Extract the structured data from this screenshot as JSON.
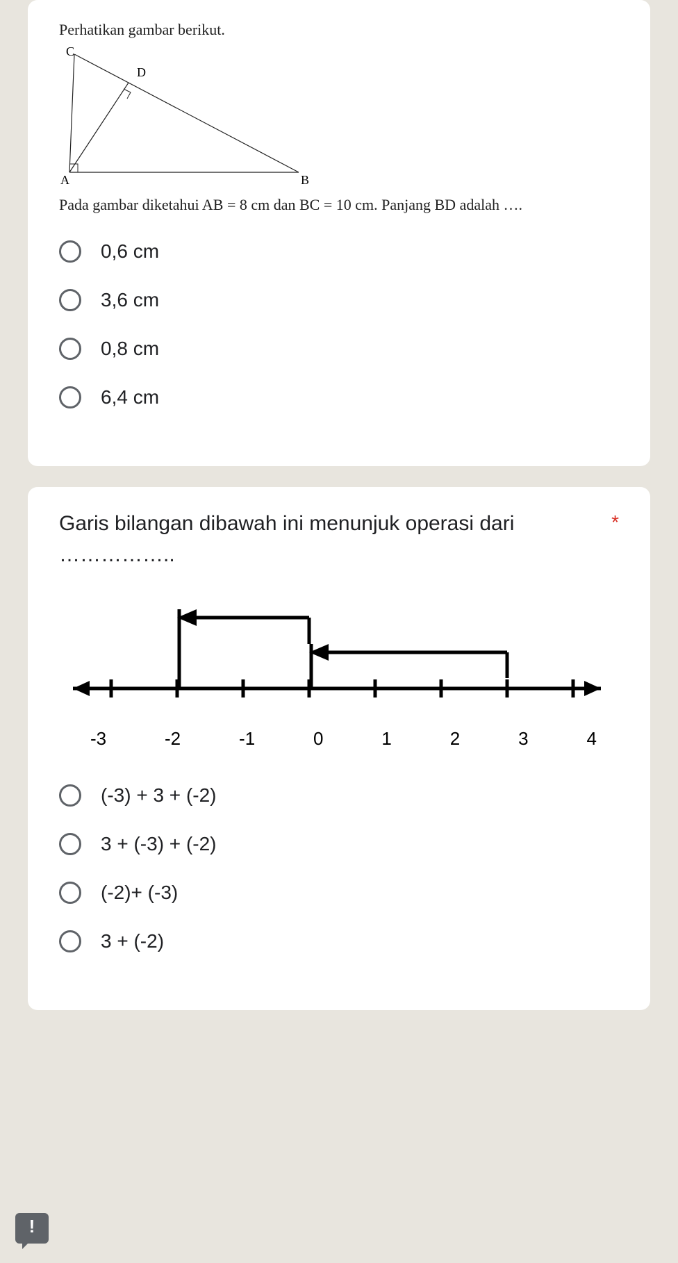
{
  "q1": {
    "header": "Perhatikan gambar berikut.",
    "labels": {
      "c": "C",
      "d": "D",
      "a": "A",
      "b": "B"
    },
    "subtext": "Pada gambar diketahui AB = 8 cm dan BC = 10 cm. Panjang BD adalah ….",
    "options": [
      "0,6 cm",
      "3,6 cm",
      "0,8 cm",
      "6,4 cm"
    ]
  },
  "q2": {
    "title": "Garis bilangan dibawah ini menunjuk operasi dari ……………..",
    "required_mark": "*",
    "numberline_labels": [
      "-3",
      "-2",
      "-1",
      "0",
      "1",
      "2",
      "3",
      "4"
    ],
    "options": [
      "(-3)  + 3 + (-2)",
      "3 + (-3) + (-2)",
      "(-2)+ (-3)",
      "3 + (-2)"
    ]
  },
  "report_icon_glyph": "!"
}
